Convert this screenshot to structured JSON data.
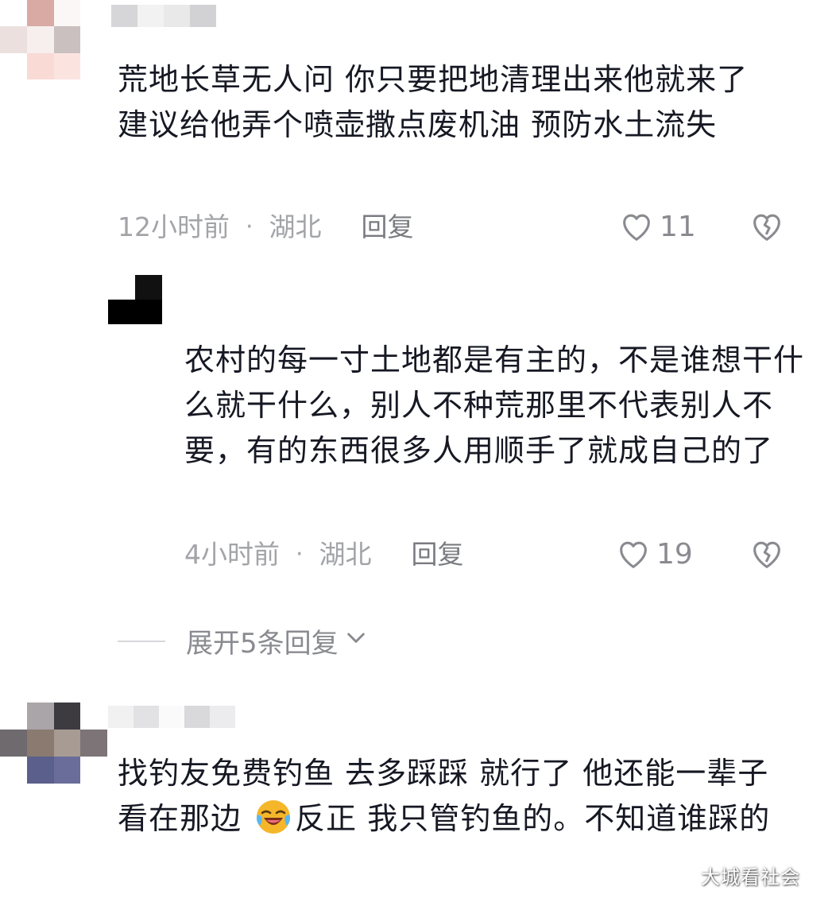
{
  "comments": [
    {
      "text": "荒地长草无人问 你只要把地清理出来他就来了 建议给他弄个喷壶撒点废机油 预防水土流失",
      "time": "12小时前",
      "separator": "·",
      "location": "湖北",
      "reply_label": "回复",
      "likes": "11"
    },
    {
      "text": "找钓友免费钓鱼 去多踩踩 就行了 他还能一辈子看在那边",
      "text_after_emoji": "反正 我只管钓鱼的。不知道谁踩的",
      "emoji_name": "laughing-tears-emoji"
    }
  ],
  "reply": {
    "text": "农村的每一寸土地都是有主的，不是谁想干什么就干什么，别人不种荒那里不代表别人不要，有的东西很多人用顺手了就成自己的了",
    "time": "4小时前",
    "separator": "·",
    "location": "湖北",
    "reply_label": "回复",
    "likes": "19"
  },
  "expand_replies": {
    "label": "展开5条回复"
  },
  "watermark": "大城看社会",
  "colors": {
    "text": "#161823",
    "meta": "#a3a4a8",
    "icon": "#8a8b90",
    "emoji": "#f5b62a"
  }
}
